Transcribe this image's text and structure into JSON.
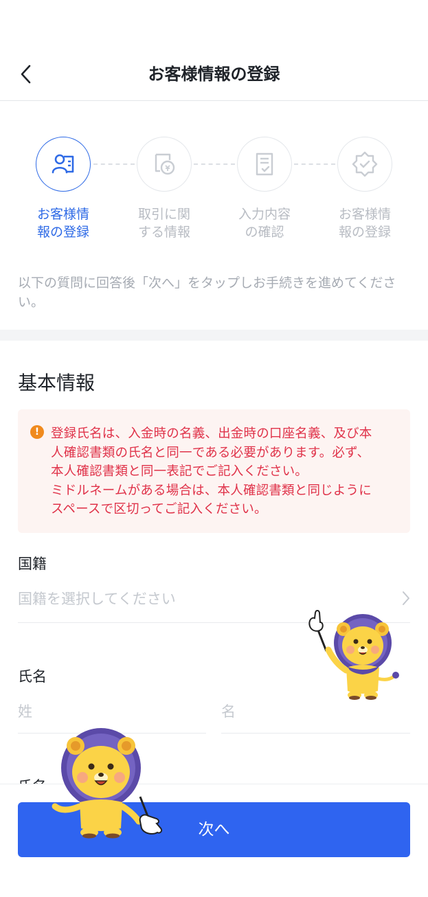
{
  "header": {
    "title": "お客様情報の登録",
    "back_icon": "chevron-left-icon"
  },
  "steps": [
    {
      "label": "お客様情\n報の登録",
      "icon": "user-card-icon",
      "active": true
    },
    {
      "label": "取引に関\nする情報",
      "icon": "coin-document-icon",
      "active": false
    },
    {
      "label": "入力内容\nの確認",
      "icon": "checklist-icon",
      "active": false
    },
    {
      "label": "お客様情\n報の登録",
      "icon": "verified-badge-icon",
      "active": false
    }
  ],
  "intro_text": "以下の質問に回答後「次へ」をタップしお手続きを進めてください。",
  "section": {
    "title": "基本情報"
  },
  "notice": {
    "icon": "warning-icon",
    "icon_glyph": "!",
    "text": "登録氏名は、入金時の名義、出金時の口座名義、及び本\n人確認書類の氏名と同一である必要があります。必ず、\n本人確認書類と同一表記でご記入ください。\nミドルネームがある場合は、本人確認書類と同じように\nスペースで区切ってご記入ください。"
  },
  "fields": {
    "nationality": {
      "label": "国籍",
      "placeholder": "国籍を選択してください"
    },
    "name": {
      "label": "氏名",
      "last_placeholder": "姓",
      "first_placeholder": "名"
    },
    "next_label_partial": "氏名"
  },
  "footer": {
    "next_label": "次へ"
  },
  "colors": {
    "accent": "#2e6ae6",
    "button": "#2f64f0",
    "notice_bg": "#fdf4f2",
    "notice_text": "#e0334a",
    "warning": "#f08a1d"
  }
}
